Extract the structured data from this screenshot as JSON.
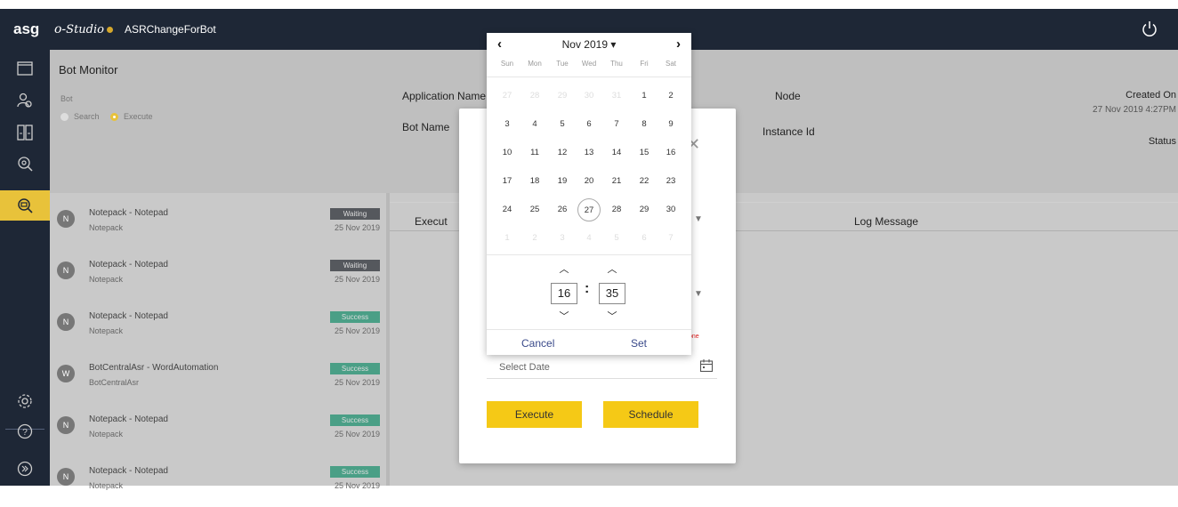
{
  "topbar": {
    "logo": "asg",
    "studio_logo": "Studio",
    "app_title": "ASRChangeForBot"
  },
  "nav_icons": [
    "window-icon",
    "users-icon",
    "columns-icon",
    "search-cog-icon",
    "bot-search-icon",
    "settings-icon",
    "help-icon",
    "expand-icon"
  ],
  "monitor": {
    "title": "Bot Monitor",
    "bot_label": "Bot",
    "radio_search": "Search",
    "radio_execute": "Execute",
    "selected_mode": "Execute",
    "application_name": "Application Name",
    "bot_name": "Bot Name",
    "node": "Node",
    "instance_id": "Instance Id",
    "created_on": "Created On",
    "created_on_value": "27 Nov 2019 4:27PM",
    "status": "Status"
  },
  "list": [
    {
      "initial": "N",
      "name": "Notepack - Notepad",
      "sub": "Notepack",
      "status": "Waiting",
      "date": "25 Nov 2019"
    },
    {
      "initial": "N",
      "name": "Notepack - Notepad",
      "sub": "Notepack",
      "status": "Waiting",
      "date": "25 Nov 2019"
    },
    {
      "initial": "N",
      "name": "Notepack - Notepad",
      "sub": "Notepack",
      "status": "Success",
      "date": "25 Nov 2019"
    },
    {
      "initial": "W",
      "name": "BotCentralAsr - WordAutomation",
      "sub": "BotCentralAsr",
      "status": "Success",
      "date": "25 Nov 2019"
    },
    {
      "initial": "N",
      "name": "Notepack - Notepad",
      "sub": "Notepack",
      "status": "Success",
      "date": "25 Nov 2019"
    },
    {
      "initial": "N",
      "name": "Notepack - Notepad",
      "sub": "Notepack",
      "status": "Success",
      "date": "25 Nov 2019"
    }
  ],
  "log": {
    "execution_header": "Execut",
    "log_message": "Log Message"
  },
  "modal": {
    "close": "✕",
    "required_text": "one",
    "date_placeholder": "Select Date",
    "execute_label": "Execute",
    "schedule_label": "Schedule"
  },
  "picker": {
    "prev": "‹",
    "next": "›",
    "month_label": "Nov 2019 ▾",
    "weekdays": [
      "Sun",
      "Mon",
      "Tue",
      "Wed",
      "Thu",
      "Fri",
      "Sat"
    ],
    "days": [
      [
        "27",
        "28",
        "29",
        "30",
        "31",
        "1",
        "2"
      ],
      [
        "3",
        "4",
        "5",
        "6",
        "7",
        "8",
        "9"
      ],
      [
        "10",
        "11",
        "12",
        "13",
        "14",
        "15",
        "16"
      ],
      [
        "17",
        "18",
        "19",
        "20",
        "21",
        "22",
        "23"
      ],
      [
        "24",
        "25",
        "26",
        "27",
        "28",
        "29",
        "30"
      ],
      [
        "1",
        "2",
        "3",
        "4",
        "5",
        "6",
        "7"
      ]
    ],
    "out_of_month": [
      [
        0,
        0
      ],
      [
        0,
        1
      ],
      [
        0,
        2
      ],
      [
        0,
        3
      ],
      [
        0,
        4
      ],
      [
        5,
        0
      ],
      [
        5,
        1
      ],
      [
        5,
        2
      ],
      [
        5,
        3
      ],
      [
        5,
        4
      ],
      [
        5,
        5
      ],
      [
        5,
        6
      ]
    ],
    "today": [
      4,
      3
    ],
    "hour": "16",
    "minute": "35",
    "cancel_label": "Cancel",
    "set_label": "Set"
  },
  "colors": {
    "accent": "#f5c916",
    "dark": "#1e2736",
    "success": "#4a9f86",
    "waiting": "#55585d"
  }
}
